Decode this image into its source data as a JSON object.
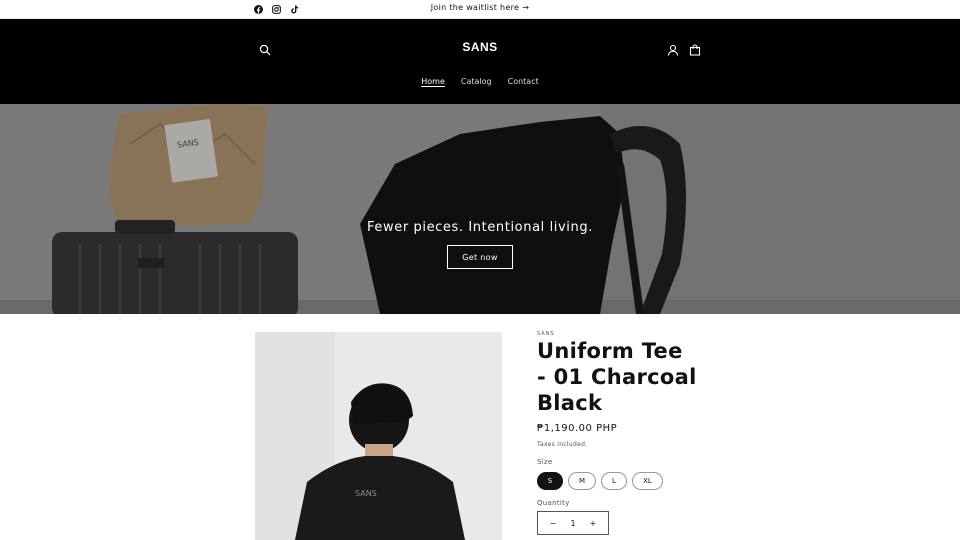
{
  "announcement": {
    "social": [
      {
        "icon": "facebook-icon"
      },
      {
        "icon": "instagram-icon"
      },
      {
        "icon": "tiktok-icon"
      }
    ],
    "text": "Join the waitlist here",
    "arrow": "→"
  },
  "header": {
    "logo": "SANS",
    "nav": [
      "Home",
      "Catalog",
      "Contact"
    ],
    "active_nav": "Home"
  },
  "hero": {
    "bag_label": "SANS",
    "title": "Fewer pieces. Intentional living.",
    "button": "Get now"
  },
  "product": {
    "vendor": "SANS",
    "title": "Uniform Tee - 01 Charcoal Black",
    "price": "₱1,190.00 PHP",
    "taxes": "Taxes included.",
    "size_label": "Size",
    "sizes": [
      "S",
      "M",
      "L",
      "XL"
    ],
    "selected_size": "S",
    "quantity_label": "Quantity",
    "quantity": "1",
    "minus": "−",
    "plus": "+",
    "shirt_label": "SANS"
  },
  "colors": {
    "header_bg": "#000000",
    "text": "#121212",
    "selected_pill": "#121212"
  }
}
